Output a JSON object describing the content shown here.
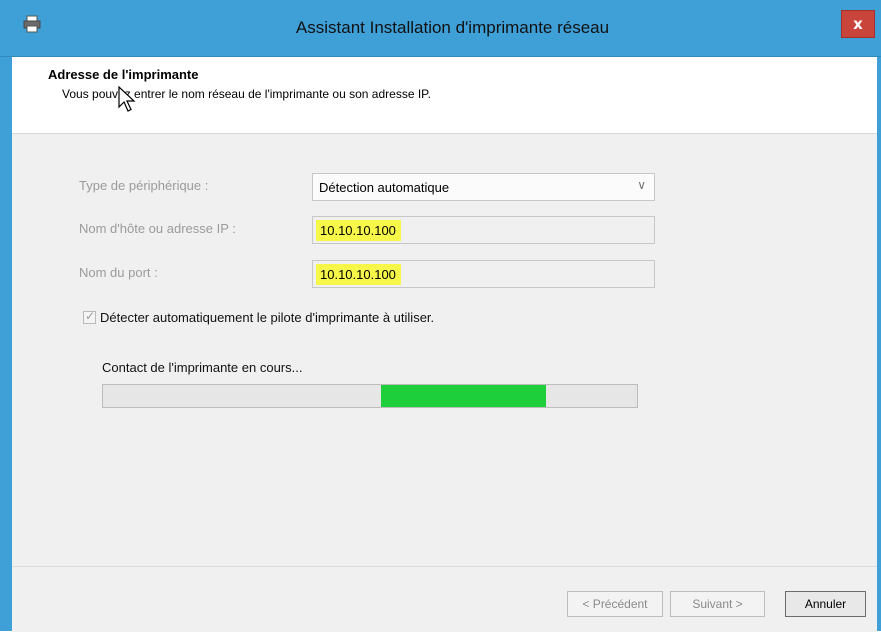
{
  "window": {
    "title": "Assistant Installation d'imprimante réseau",
    "close_label": "x",
    "accent_color": "#3fa0d8",
    "close_color": "#c9443a"
  },
  "header": {
    "title": "Adresse de l'imprimante",
    "subtitle": "Vous pouvez entrer le nom réseau de l'imprimante ou son adresse IP."
  },
  "form": {
    "device_type_label": "Type de périphérique :",
    "device_type_value": "Détection automatique",
    "hostname_label": "Nom d'hôte ou adresse IP :",
    "hostname_value": "10.10.10.100",
    "port_label": "Nom du port :",
    "port_value": "10.10.10.100",
    "autodetect_label": "Détecter automatiquement le pilote d'imprimante à utiliser.",
    "autodetect_checked": true,
    "highlight_color": "#f7f74a"
  },
  "status": {
    "text": "Contact de l'imprimante en cours...",
    "progress_fill_color": "#1ecf3c"
  },
  "buttons": {
    "previous": "< Précédent",
    "next": "Suivant >",
    "cancel": "Annuler"
  }
}
